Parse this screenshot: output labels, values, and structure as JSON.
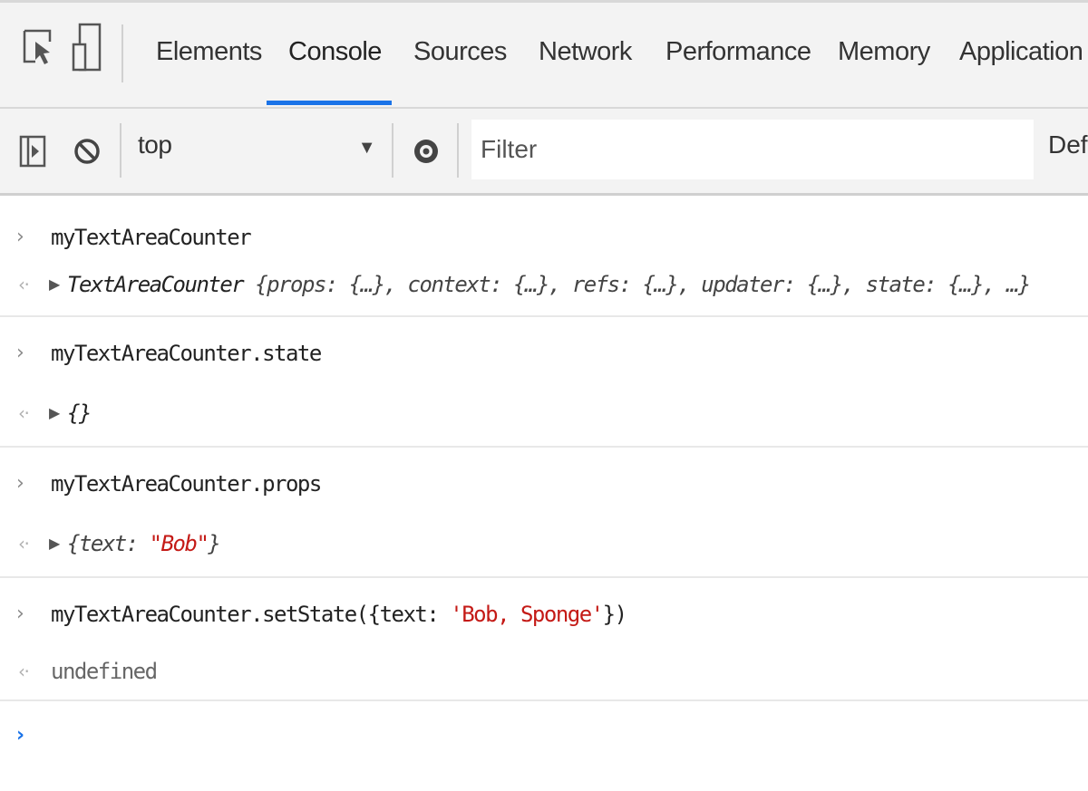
{
  "toolbar_icons": {
    "inspect": "inspect-element-icon",
    "device": "device-toggle-icon",
    "sidebar": "sidebar-toggle-icon",
    "clear": "clear-console-icon",
    "live_expression": "eye-icon"
  },
  "tabs": [
    {
      "label": "Elements"
    },
    {
      "label": "Console"
    },
    {
      "label": "Sources"
    },
    {
      "label": "Network"
    },
    {
      "label": "Performance"
    },
    {
      "label": "Memory"
    },
    {
      "label": "Application"
    }
  ],
  "active_tab": "Console",
  "console_toolbar": {
    "context": "top",
    "filter_placeholder": "Filter",
    "levels_label": "Def"
  },
  "entries": [
    {
      "type": "input",
      "text": "myTextAreaCounter"
    },
    {
      "type": "output",
      "cls": "TextAreaCounter",
      "text": "{props: {…}, context: {…}, refs: {…}, updater: {…}, state: {…}, …}"
    },
    {
      "type": "input",
      "text": "myTextAreaCounter.state"
    },
    {
      "type": "output",
      "text": "{}"
    },
    {
      "type": "input",
      "text": "myTextAreaCounter.props"
    },
    {
      "type": "output",
      "prefix": "{text: ",
      "str": "\"Bob\"",
      "suffix": "}"
    },
    {
      "type": "input",
      "prefix": "myTextAreaCounter.setState({text: ",
      "str": "'Bob, Sponge'",
      "suffix": "})"
    },
    {
      "type": "output",
      "text": "undefined"
    }
  ],
  "colors": {
    "accent": "#1a73e8",
    "string": "#c41a16",
    "toolbar_bg": "#f3f3f3"
  }
}
